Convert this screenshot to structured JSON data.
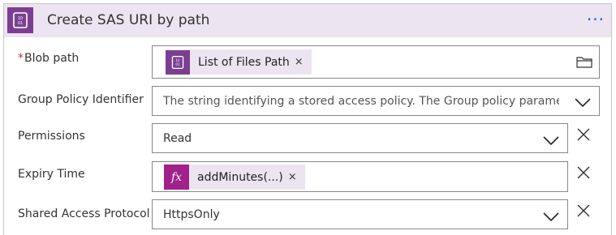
{
  "action": {
    "title": "Create SAS URI by path",
    "icon": "blob-storage-icon",
    "more_label": "···"
  },
  "fields": {
    "blob_path": {
      "required_marker": "*",
      "label": "Blob path",
      "token_label": "List of Files Path",
      "token_icon": "blob-storage-icon",
      "token_remove": "×",
      "browse_icon": "folder-icon"
    },
    "group_policy": {
      "label": "Group Policy Identifier",
      "placeholder": "The string identifying a stored access policy. The Group policy parameters (e"
    },
    "permissions": {
      "label": "Permissions",
      "value": "Read"
    },
    "expiry_time": {
      "label": "Expiry Time",
      "token_label": "addMinutes(...)",
      "token_icon_text": "fx",
      "token_remove": "×"
    },
    "protocol": {
      "label": "Shared Access Protocol",
      "value": "HttpsOnly"
    }
  },
  "colors": {
    "accent_purple": "#7b3f92",
    "header_bg": "#ede4f2",
    "expression_purple": "#a0208c",
    "link_blue": "#0a5bd6"
  }
}
